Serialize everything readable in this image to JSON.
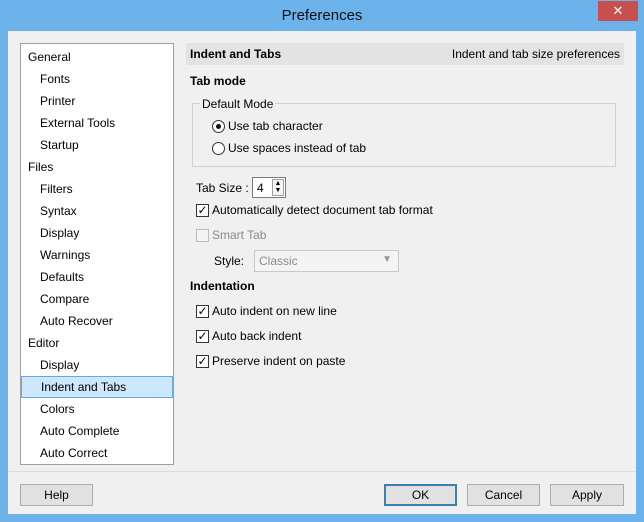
{
  "window": {
    "title": "Preferences",
    "close_glyph": "✕"
  },
  "sidebar": {
    "items": [
      {
        "label": "General",
        "level": 0
      },
      {
        "label": "Fonts",
        "level": 1
      },
      {
        "label": "Printer",
        "level": 1
      },
      {
        "label": "External Tools",
        "level": 1
      },
      {
        "label": "Startup",
        "level": 1
      },
      {
        "label": "Files",
        "level": 0
      },
      {
        "label": "Filters",
        "level": 1
      },
      {
        "label": "Syntax",
        "level": 1
      },
      {
        "label": "Display",
        "level": 1
      },
      {
        "label": "Warnings",
        "level": 1
      },
      {
        "label": "Defaults",
        "level": 1
      },
      {
        "label": "Compare",
        "level": 1
      },
      {
        "label": "Auto Recover",
        "level": 1
      },
      {
        "label": "Editor",
        "level": 0
      },
      {
        "label": "Display",
        "level": 1
      },
      {
        "label": "Indent and Tabs",
        "level": 1,
        "selected": true
      },
      {
        "label": "Colors",
        "level": 1
      },
      {
        "label": "Auto Complete",
        "level": 1
      },
      {
        "label": "Auto Correct",
        "level": 1
      }
    ]
  },
  "panel": {
    "header_title": "Indent and Tabs",
    "header_subtitle": "Indent and tab size preferences",
    "tab_mode_heading": "Tab mode",
    "default_mode_label": "Default  Mode",
    "use_tab_label": "Use tab character",
    "use_tab_selected": true,
    "use_spaces_label": "Use spaces instead of tab",
    "use_spaces_selected": false,
    "tab_size_label": "Tab Size :",
    "tab_size_value": "4",
    "auto_detect_label": "Automatically detect document tab format",
    "auto_detect_checked": true,
    "smart_tab_label": "Smart Tab",
    "smart_tab_checked": false,
    "style_label": "Style:",
    "style_value": "Classic",
    "indentation_heading": "Indentation",
    "auto_indent_label": "Auto indent on new line",
    "auto_indent_checked": true,
    "auto_back_indent_label": "Auto back indent",
    "auto_back_indent_checked": true,
    "preserve_indent_label": "Preserve indent on paste",
    "preserve_indent_checked": true,
    "check_glyph": "✓",
    "spin_up": "▲",
    "spin_down": "▼",
    "dropdown_glyph": "▼"
  },
  "buttons": {
    "help": "Help",
    "ok": "OK",
    "cancel": "Cancel",
    "apply": "Apply"
  }
}
